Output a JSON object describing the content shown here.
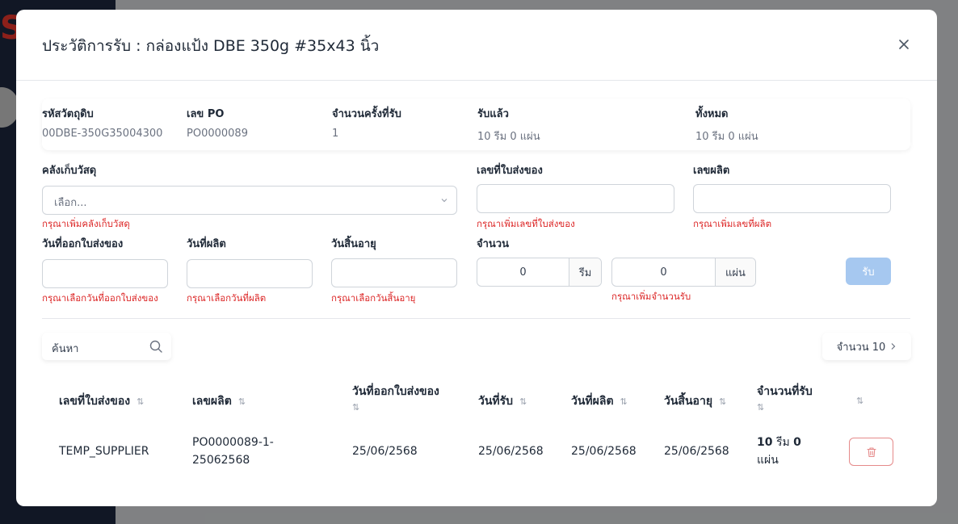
{
  "modal": {
    "title": "ประวัติการรับ : กล่องแป้ง DBE 350g #35x43 นิ้ว"
  },
  "info": {
    "material_code_label": "รหัสวัตถุดิบ",
    "material_code_value": "00DBE-350G35004300",
    "po_label": "เลข PO",
    "po_value": "PO0000089",
    "receive_count_label": "จำนวนครั้งที่รับ",
    "receive_count_value": "1",
    "received_label": "รับแล้ว",
    "received_value": "10 รีม 0 แผ่น",
    "total_label": "ทั้งหมด",
    "total_value": "10 รีม 0 แผ่น"
  },
  "form": {
    "warehouse_label": "คลังเก็บวัสดุ",
    "warehouse_placeholder": "เลือก...",
    "warehouse_error": "กรุณาเพิ่มคลังเก็บวัสดุ",
    "delivery_no_label": "เลขที่ใบส่งของ",
    "delivery_no_error": "กรุณาเพิ่มเลขที่ใบส่งของ",
    "lot_label": "เลขผลิต",
    "lot_error": "กรุณาเพิ่มเลขที่ผลิต",
    "delivery_date_label": "วันที่ออกใบส่งของ",
    "delivery_date_error": "กรุณาเลือกวันที่ออกใบส่งของ",
    "mfg_date_label": "วันที่ผลิต",
    "mfg_date_error": "กรุณาเลือกวันที่ผลิต",
    "exp_date_label": "วันสิ้นอายุ",
    "exp_date_error": "กรุณาเลือกวันสิ้นอายุ",
    "quantity_label": "จำนวน",
    "ream_value": "0",
    "ream_unit": "รีม",
    "sheet_value": "0",
    "sheet_unit": "แผ่น",
    "quantity_error": "กรุณาเพิ่มจำนวนรับ",
    "receive_button": "รับ"
  },
  "table_controls": {
    "search_placeholder": "ค้นหา",
    "count_label": "จำนวน 10"
  },
  "table": {
    "headers": [
      "เลขที่ใบส่งของ",
      "เลขผลิต",
      "วันที่ออกใบส่งของ",
      "วันที่รับ",
      "วันที่ผลิต",
      "วันสิ้นอายุ",
      "จำนวนที่รับ"
    ],
    "rows": [
      {
        "delivery_no": "TEMP_SUPPLIER",
        "lot": "PO0000089-1-25062568",
        "delivery_date": "25/06/2568",
        "received_date": "25/06/2568",
        "mfg_date": "25/06/2568",
        "exp_date": "25/06/2568",
        "qty_ream_num": "10",
        "qty_ream_unit": "รีม",
        "qty_sheet_num": "0",
        "qty_sheet_unit": "แผ่น"
      }
    ]
  },
  "colors": {
    "error": "#dc2626",
    "primary_disabled": "#a6c8f0",
    "delete_border": "#e58a8a",
    "sidebar": "#1f2a44"
  }
}
